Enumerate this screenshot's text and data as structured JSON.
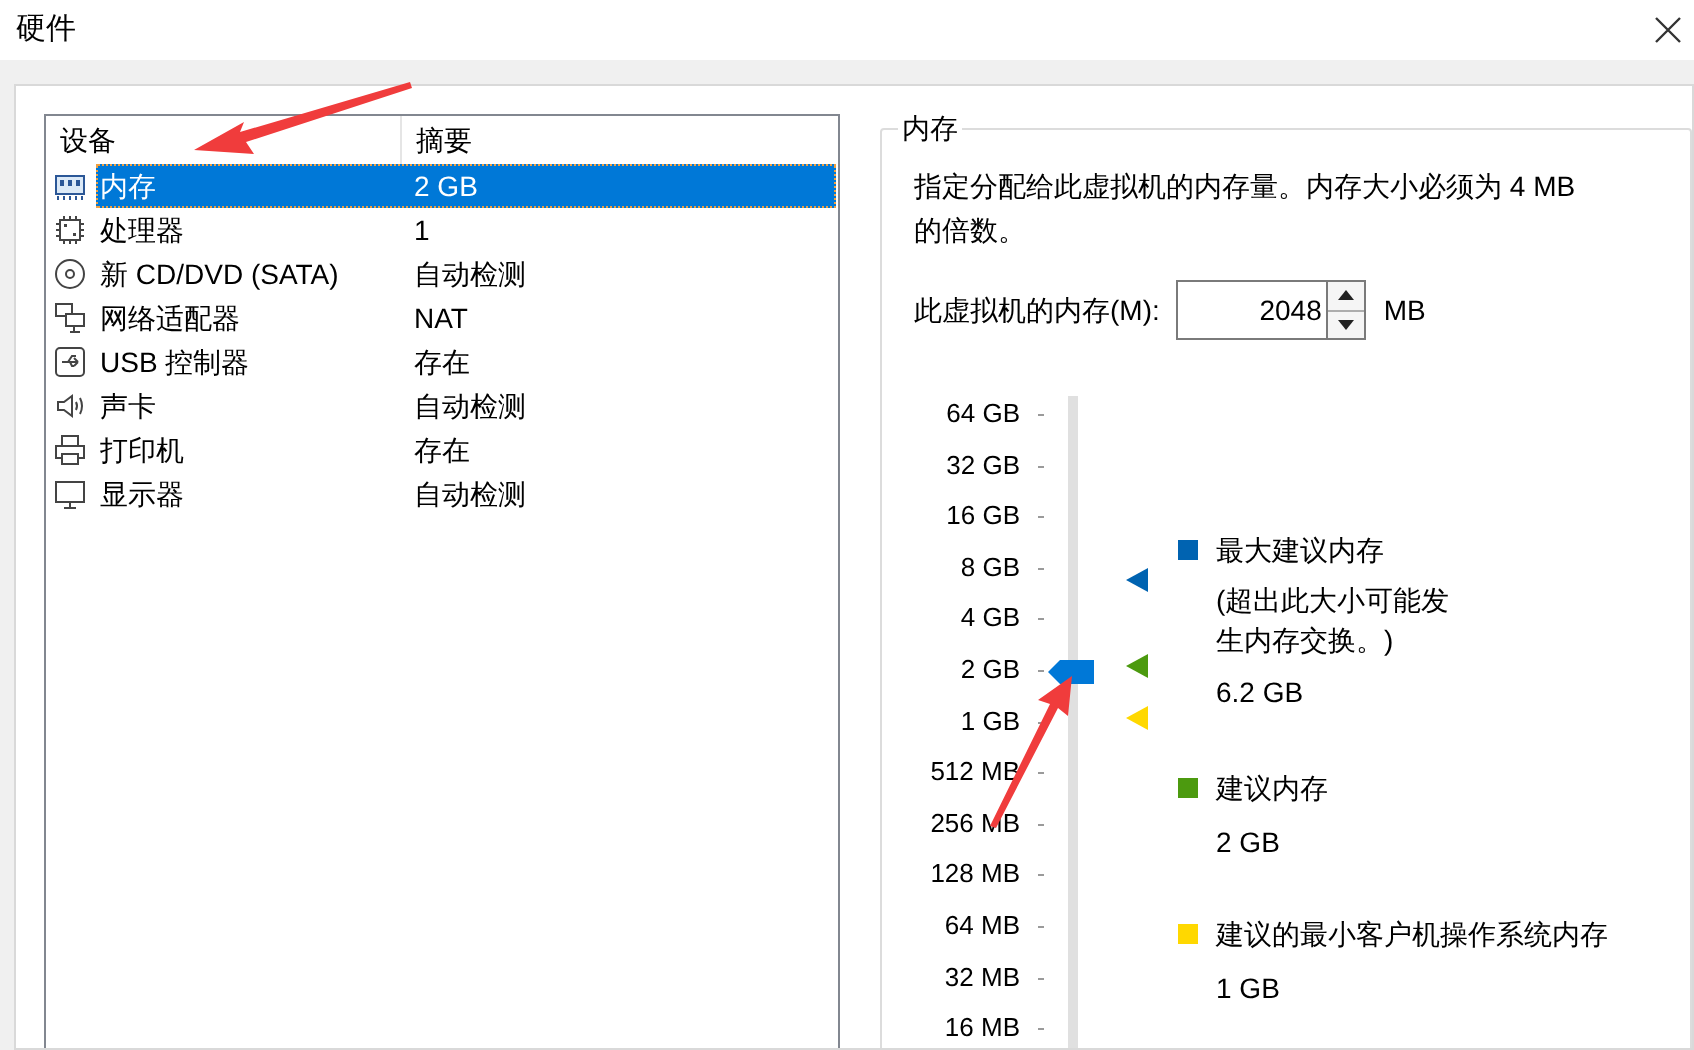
{
  "window": {
    "title": "硬件"
  },
  "device_list": {
    "columns": [
      "设备",
      "摘要"
    ],
    "rows": [
      {
        "kind": "memory",
        "device": "内存",
        "summary": "2 GB",
        "selected": true
      },
      {
        "kind": "cpu",
        "device": "处理器",
        "summary": "1",
        "selected": false
      },
      {
        "kind": "cdrom",
        "device": "新 CD/DVD (SATA)",
        "summary": "自动检测",
        "selected": false
      },
      {
        "kind": "network",
        "device": "网络适配器",
        "summary": "NAT",
        "selected": false
      },
      {
        "kind": "usb",
        "device": "USB 控制器",
        "summary": "存在",
        "selected": false
      },
      {
        "kind": "sound",
        "device": "声卡",
        "summary": "自动检测",
        "selected": false
      },
      {
        "kind": "printer",
        "device": "打印机",
        "summary": "存在",
        "selected": false
      },
      {
        "kind": "display",
        "device": "显示器",
        "summary": "自动检测",
        "selected": false
      }
    ]
  },
  "memory_panel": {
    "title": "内存",
    "description": "指定分配给此虚拟机的内存量。内存大小必须为 4 MB 的倍数。",
    "field_label": "此虚拟机的内存(M):",
    "value": "2048",
    "unit": "MB",
    "slider": {
      "level": 0.58
    },
    "scale": [
      "64 GB",
      "32 GB",
      "16 GB",
      "8 GB",
      "4 GB",
      "2 GB",
      "1 GB",
      "512 MB",
      "256 MB",
      "128 MB",
      "64 MB",
      "32 MB",
      "16 MB"
    ],
    "legend": [
      {
        "title": "最大建议内存",
        "note": "(超出此大小可能发生内存交换。)",
        "value": "6.2 GB",
        "color": "#0063b1"
      },
      {
        "title": "建议内存",
        "value": "2 GB",
        "color": "#4c9a0f"
      },
      {
        "title": "建议的最小客户机操作系统内存",
        "value": "1 GB",
        "color": "#ffd800"
      }
    ]
  }
}
